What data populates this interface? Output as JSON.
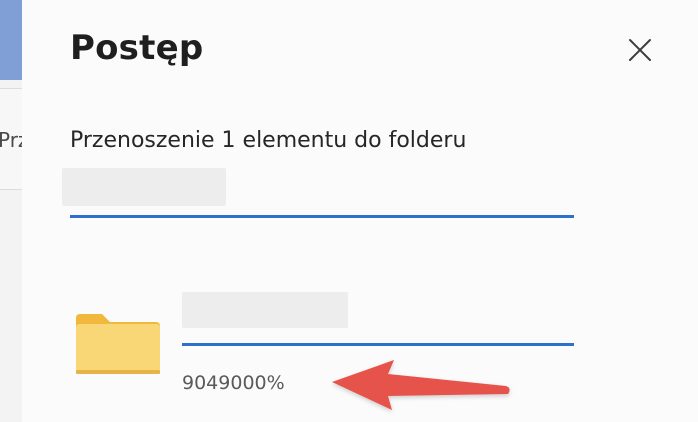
{
  "background": {
    "cut_label": "Prz"
  },
  "dialog": {
    "title": "Postęp",
    "close_icon": "close-icon",
    "subtitle": "Przenoszenie 1 elementu do folderu",
    "destination_name": "",
    "overall_progress": 1.0,
    "item": {
      "icon": "folder-icon",
      "name": "",
      "progress": 1.0,
      "percent_label": "9049000%"
    }
  },
  "colors": {
    "accent": "#2f6fd0",
    "annotation_arrow": "#e5534b",
    "folder_front": "#f9d776",
    "folder_back": "#f0b93e"
  }
}
